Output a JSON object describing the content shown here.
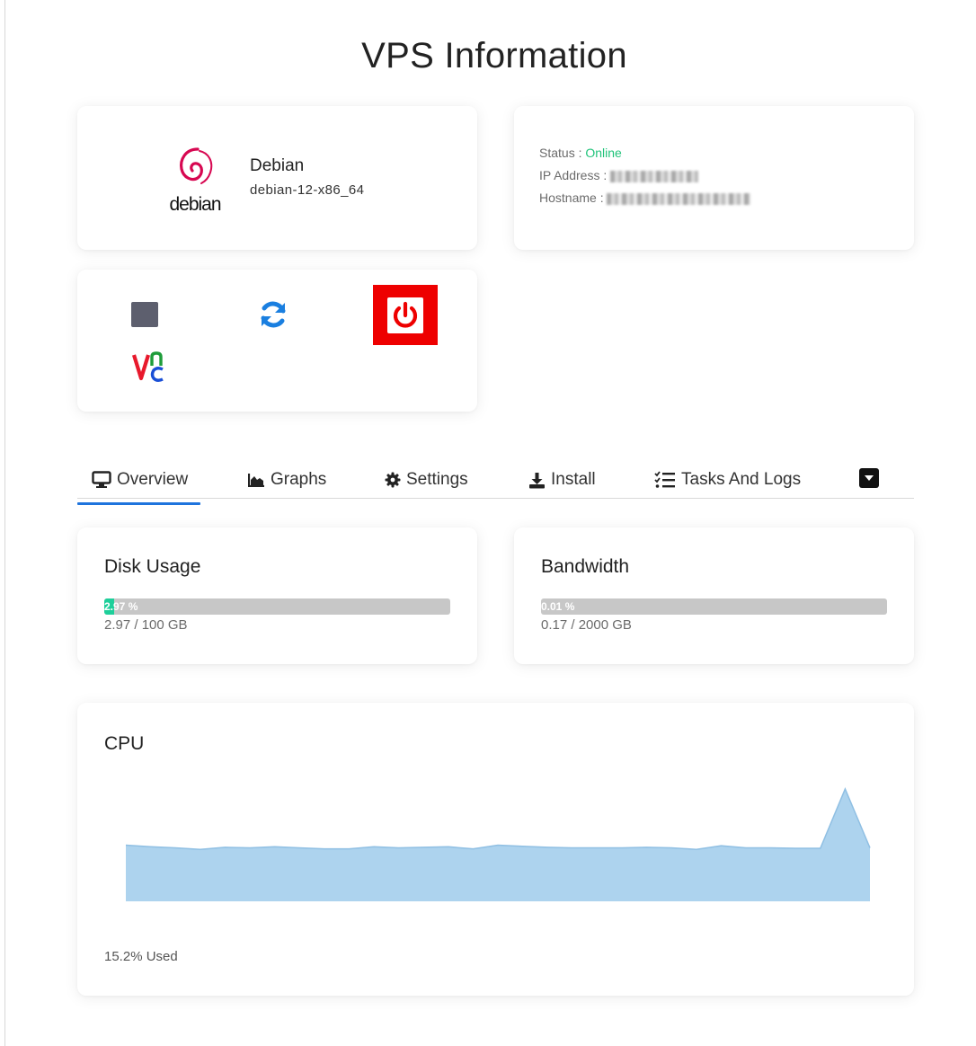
{
  "page": {
    "title": "VPS Information"
  },
  "os": {
    "name": "Debian",
    "template": "debian-12-x86_64",
    "logo_text": "debian",
    "logo_color": "#d70751"
  },
  "server_info": {
    "status_label": "Status :",
    "status_value": "Online",
    "ip_label": "IP Address :",
    "hostname_label": "Hostname :",
    "status_color": "#20c37a"
  },
  "controls": {
    "stop_icon": "stop-icon",
    "restart_icon": "refresh-icon",
    "power_icon": "power-icon",
    "vnc_icon": "vnc-icon"
  },
  "tabs": [
    {
      "label": "Overview",
      "icon": "monitor-icon",
      "active": true
    },
    {
      "label": "Graphs",
      "icon": "chart-icon",
      "active": false
    },
    {
      "label": "Settings",
      "icon": "gear-icon",
      "active": false
    },
    {
      "label": "Install",
      "icon": "download-icon",
      "active": false
    },
    {
      "label": "Tasks And Logs",
      "icon": "list-icon",
      "active": false
    }
  ],
  "disk": {
    "title": "Disk Usage",
    "percent_label": "2.97 %",
    "percent": 2.97,
    "detail": "2.97 / 100 GB"
  },
  "bandwidth": {
    "title": "Bandwidth",
    "percent_label": "0.01 %",
    "percent": 0.01,
    "detail": "0.17 / 2000 GB"
  },
  "cpu": {
    "title": "CPU",
    "used_label": "15.2% Used",
    "fill_color": "#add3ee",
    "stroke_color": "#8fbfe3"
  },
  "chart_data": {
    "type": "area",
    "title": "CPU",
    "series": [
      {
        "values": [
          10.5,
          10.2,
          10.0,
          9.7,
          10.1,
          10.0,
          10.2,
          10.0,
          9.8,
          9.8,
          10.2,
          10.0,
          10.1,
          10.2,
          9.8,
          10.5,
          10.3,
          10.1,
          10.0,
          10.0,
          10.0,
          10.1,
          10.0,
          9.7,
          10.4,
          10.0,
          10.0,
          9.9,
          9.9,
          21.0,
          10.0
        ]
      }
    ],
    "ylim": [
      0,
      22
    ],
    "grid": false,
    "legend": "none"
  }
}
